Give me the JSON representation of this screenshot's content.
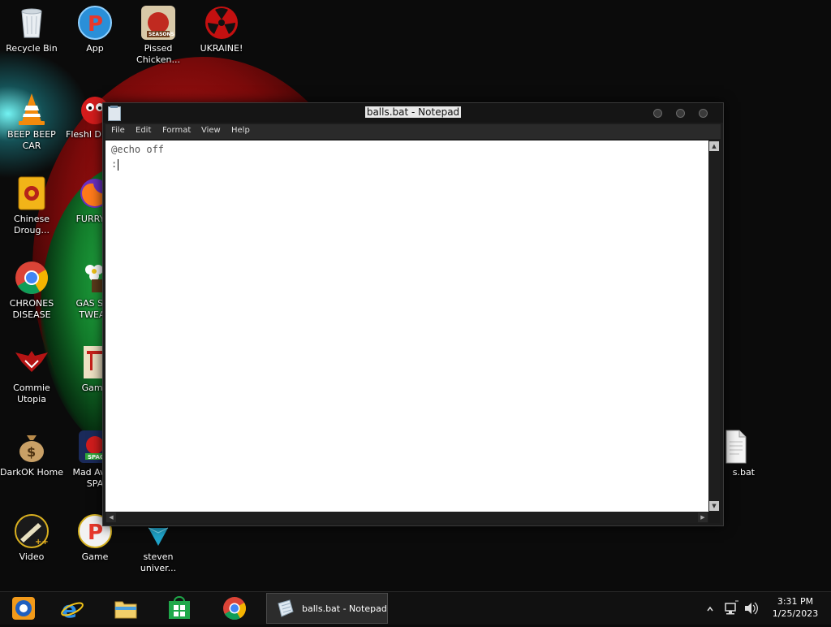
{
  "desktop": {
    "icons": [
      {
        "label": "Recycle Bin"
      },
      {
        "label": "App"
      },
      {
        "label": "Pissed Chicken..."
      },
      {
        "label": "UKRAINE!"
      },
      {
        "label": "BEEP BEEP CAR"
      },
      {
        "label": "Fleshl DELUX"
      },
      {
        "label": "Chinese Droug..."
      },
      {
        "label": "FURRY C"
      },
      {
        "label": "CHRONES DISEASE"
      },
      {
        "label": "GAS STA TWEAK"
      },
      {
        "label": "Commie Utopia"
      },
      {
        "label": "Game"
      },
      {
        "label": "DarkOK Home"
      },
      {
        "label": "Mad Av IN SPA"
      },
      {
        "label": "s.bat"
      },
      {
        "label": "Video"
      },
      {
        "label": "Game"
      },
      {
        "label": "steven univer..."
      }
    ]
  },
  "notepad": {
    "title": "balls.bat - Notepad",
    "menu": [
      "File",
      "Edit",
      "Format",
      "View",
      "Help"
    ],
    "content_lines": [
      "@echo off",
      ":"
    ]
  },
  "taskbar": {
    "active_window_label": "balls.bat - Notepad",
    "pinned": [
      "media-player-icon",
      "internet-explorer-icon",
      "file-explorer-icon",
      "store-icon",
      "chrome-icon"
    ],
    "tray_icons": [
      "show-hidden-icons-arrow",
      "network-icon",
      "volume-icon"
    ],
    "time": "3:31 PM",
    "date": "1/25/2023"
  },
  "colors": {
    "taskbar_bg": "#111111",
    "window_frame": "#1c1c1c",
    "editor_bg": "#ffffff"
  }
}
